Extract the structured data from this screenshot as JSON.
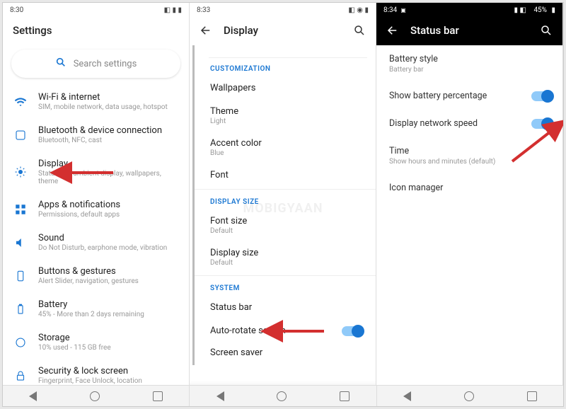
{
  "watermark": "MOBIGYAAN",
  "col1": {
    "status": {
      "time": "8:30",
      "icons": "◧ ▮ ▮"
    },
    "title": "Settings",
    "search_placeholder": "Search settings",
    "items": [
      {
        "icon": "wifi",
        "title": "Wi-Fi & internet",
        "sub": "SIM, mobile network, data usage, hotspot"
      },
      {
        "icon": "bt",
        "title": "Bluetooth & device connection",
        "sub": "Bluetooth, NFC, cast"
      },
      {
        "icon": "display",
        "title": "Display",
        "sub": "Status bar, ambient display, wallpapers, theme"
      },
      {
        "icon": "apps",
        "title": "Apps & notifications",
        "sub": "Permissions, default apps"
      },
      {
        "icon": "sound",
        "title": "Sound",
        "sub": "Do Not Disturb, earphone mode, vibration"
      },
      {
        "icon": "gest",
        "title": "Buttons & gestures",
        "sub": "Alert Slider, navigation, gestures"
      },
      {
        "icon": "battery",
        "title": "Battery",
        "sub": "45% - More than 2 days remaining"
      },
      {
        "icon": "storage",
        "title": "Storage",
        "sub": "10% used - 115 GB free"
      },
      {
        "icon": "lock",
        "title": "Security & lock screen",
        "sub": "Fingerprint, Face Unlock, location"
      }
    ]
  },
  "col2": {
    "status": {
      "time": "8:33",
      "icons": "◧ ◉ ▮"
    },
    "title": "Display",
    "sections": [
      {
        "label": "CUSTOMIZATION",
        "rows": [
          {
            "title": "Wallpapers",
            "sub": ""
          },
          {
            "title": "Theme",
            "sub": "Light"
          },
          {
            "title": "Accent color",
            "sub": "Blue"
          },
          {
            "title": "Font",
            "sub": ""
          }
        ]
      },
      {
        "label": "DISPLAY SIZE",
        "rows": [
          {
            "title": "Font size",
            "sub": "Default"
          },
          {
            "title": "Display size",
            "sub": "Default"
          }
        ]
      },
      {
        "label": "SYSTEM",
        "rows": [
          {
            "title": "Status bar",
            "sub": ""
          },
          {
            "title": "Auto-rotate screen",
            "sub": "",
            "toggle": true
          },
          {
            "title": "Screen saver",
            "sub": ""
          }
        ]
      }
    ]
  },
  "col3": {
    "status": {
      "time": "8:34",
      "battery": "45%",
      "icons": "▮ ◧"
    },
    "title": "Status bar",
    "rows": [
      {
        "title": "Battery style",
        "sub": "Battery bar"
      },
      {
        "title": "Show battery percentage",
        "toggle": true
      },
      {
        "title": "Display network speed",
        "toggle": true
      },
      {
        "title": "Time",
        "sub": "Show hours and minutes (default)"
      },
      {
        "title": "Icon manager"
      }
    ]
  }
}
